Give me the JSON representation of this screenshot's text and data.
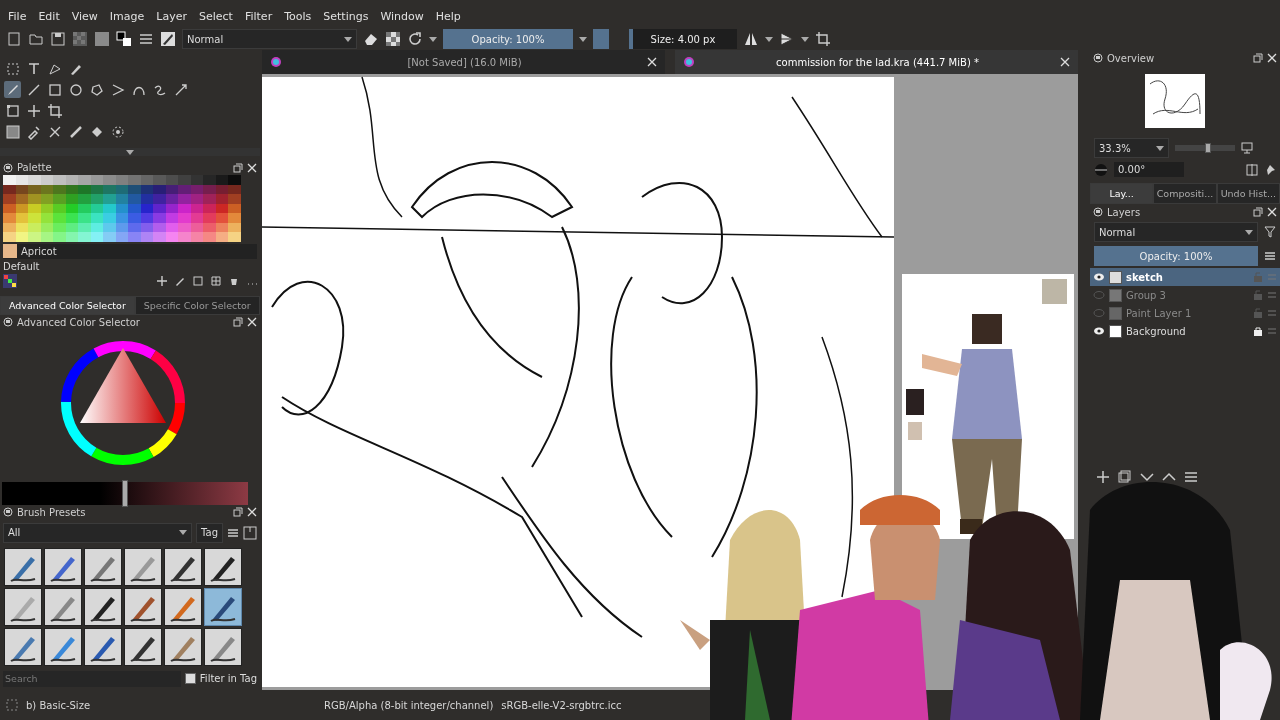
{
  "menu": [
    "File",
    "Edit",
    "View",
    "Image",
    "Layer",
    "Select",
    "Filter",
    "Tools",
    "Settings",
    "Window",
    "Help"
  ],
  "toolbar": {
    "blend_mode": "Normal",
    "opacity": {
      "label": "Opacity: 100%",
      "level": 1
    },
    "size": {
      "label": "Size: 4.00 px",
      "level": 0.04
    }
  },
  "tools": [
    [
      {
        "kind": "select",
        "selected": false
      },
      {
        "kind": "text",
        "selected": false
      },
      {
        "kind": "edit-shape",
        "selected": false
      },
      {
        "kind": "calligraphy",
        "selected": false
      }
    ],
    [
      {
        "kind": "brush",
        "selected": true
      },
      {
        "kind": "line",
        "selected": false
      },
      {
        "kind": "rectangle",
        "selected": false
      },
      {
        "kind": "ellipse",
        "selected": false
      },
      {
        "kind": "polygon",
        "selected": false
      },
      {
        "kind": "polyline",
        "selected": false
      },
      {
        "kind": "bezier",
        "selected": false
      },
      {
        "kind": "freehand-path",
        "selected": false
      },
      {
        "kind": "multibrush",
        "selected": false
      }
    ],
    [
      {
        "kind": "transform",
        "selected": false
      },
      {
        "kind": "move",
        "selected": false
      },
      {
        "kind": "crop",
        "selected": false
      }
    ],
    [
      {
        "kind": "gradient",
        "selected": false
      },
      {
        "kind": "picker",
        "selected": false
      },
      {
        "kind": "assistant",
        "selected": false
      },
      {
        "kind": "measure",
        "selected": false
      },
      {
        "kind": "fill",
        "selected": false
      },
      {
        "kind": "smart-patch",
        "selected": false
      }
    ]
  ],
  "palette": {
    "title": "Palette",
    "color_name": "Apricot",
    "color": "#e6b78a",
    "set_name": "Default"
  },
  "color_selector": {
    "shade": {
      "level": 0.5
    },
    "tabs": [
      {
        "label": "Advanced Color Selector",
        "selected": true
      },
      {
        "label": "Specific Color Selector",
        "selected": false
      }
    ],
    "title": "Advanced Color Selector"
  },
  "brush_presets": {
    "title": "Brush Presets",
    "filter": "All",
    "tag": "Tag",
    "presets": [
      {
        "selected": false
      },
      {
        "selected": false
      },
      {
        "selected": false
      },
      {
        "selected": false
      },
      {
        "selected": false
      },
      {
        "selected": false
      },
      {
        "selected": false
      },
      {
        "selected": false
      },
      {
        "selected": false
      },
      {
        "selected": false
      },
      {
        "selected": false
      },
      {
        "selected": true
      },
      {
        "selected": false
      },
      {
        "selected": false
      },
      {
        "selected": false
      },
      {
        "selected": false
      },
      {
        "selected": false
      },
      {
        "selected": false
      }
    ],
    "search_placeholder": "Search",
    "filter_in_tag": {
      "label": "Filter in Tag",
      "checked": true
    },
    "current": "b) Basic-Size"
  },
  "documents": [
    {
      "title": "[Not Saved]  (16.0 MiB)",
      "selected": false
    },
    {
      "title": "commission for the lad.kra (441.7 MiB) *",
      "selected": true
    }
  ],
  "overview": {
    "title": "Overview",
    "zoom": "33.3%",
    "zoom_slider": {
      "level": 0.55
    },
    "rotation": "0.00°"
  },
  "dock_tabs": [
    {
      "label": "Lay...",
      "selected": true
    },
    {
      "label": "Compositi...",
      "selected": false
    },
    {
      "label": "Undo Hist...",
      "selected": false
    }
  ],
  "layers": {
    "title": "Layers",
    "blend_mode": "Normal",
    "opacity": {
      "label": "Opacity:  100%",
      "level": 1
    },
    "items": [
      {
        "name": "sketch",
        "kind": "paint",
        "visible": true,
        "selected": true,
        "locked": false
      },
      {
        "name": "Group 3",
        "kind": "group",
        "visible": false,
        "selected": false,
        "locked": false
      },
      {
        "name": "Paint Layer 1",
        "kind": "paint",
        "visible": false,
        "selected": false,
        "locked": false
      },
      {
        "name": "Background",
        "kind": "fill",
        "visible": true,
        "selected": false,
        "locked": true
      }
    ]
  },
  "status_bar": {
    "color_space": "RGB/Alpha (8-bit integer/channel)",
    "profile": "sRGB-elle-V2-srgbtrc.icc"
  }
}
